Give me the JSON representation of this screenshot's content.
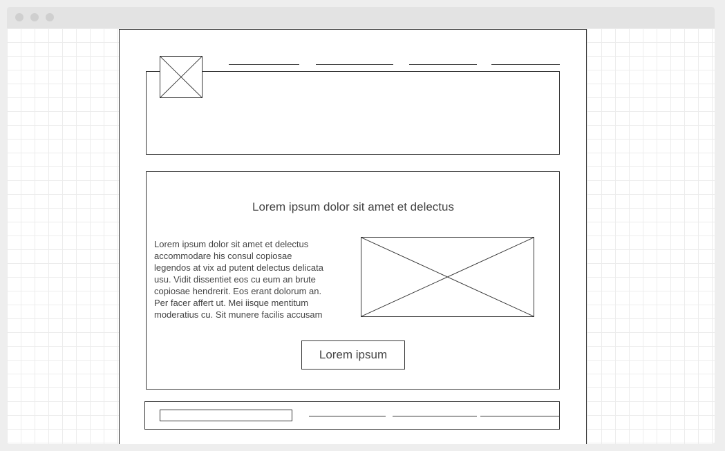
{
  "window": {
    "controls": [
      "window-dot-icon",
      "window-dot-icon",
      "window-dot-icon"
    ]
  },
  "colors": {
    "stroke": "#333333",
    "text": "#444444",
    "grid": "#ececec",
    "titlebar": "#e3e3e3"
  },
  "header": {
    "logo_icon": "image-placeholder-icon",
    "nav_link_count": 4
  },
  "content": {
    "heading": "Lorem ipsum dolor sit amet et delectus",
    "body_lines": [
      "Lorem ipsum dolor sit amet et delectus",
      "accommodare his consul copiosae",
      "legendos at vix ad putent delectus delicata",
      "usu. Vidit dissentiet eos cu eum an brute",
      "copiosae hendrerit. Eos erant dolorum an.",
      "Per facer affert ut. Mei iisque mentitum",
      "moderatius cu. Sit munere facilis accusam"
    ],
    "image_icon": "image-placeholder-icon",
    "button_label": "Lorem ipsum"
  },
  "footer": {
    "input_placeholder": "",
    "link_count": 3
  }
}
